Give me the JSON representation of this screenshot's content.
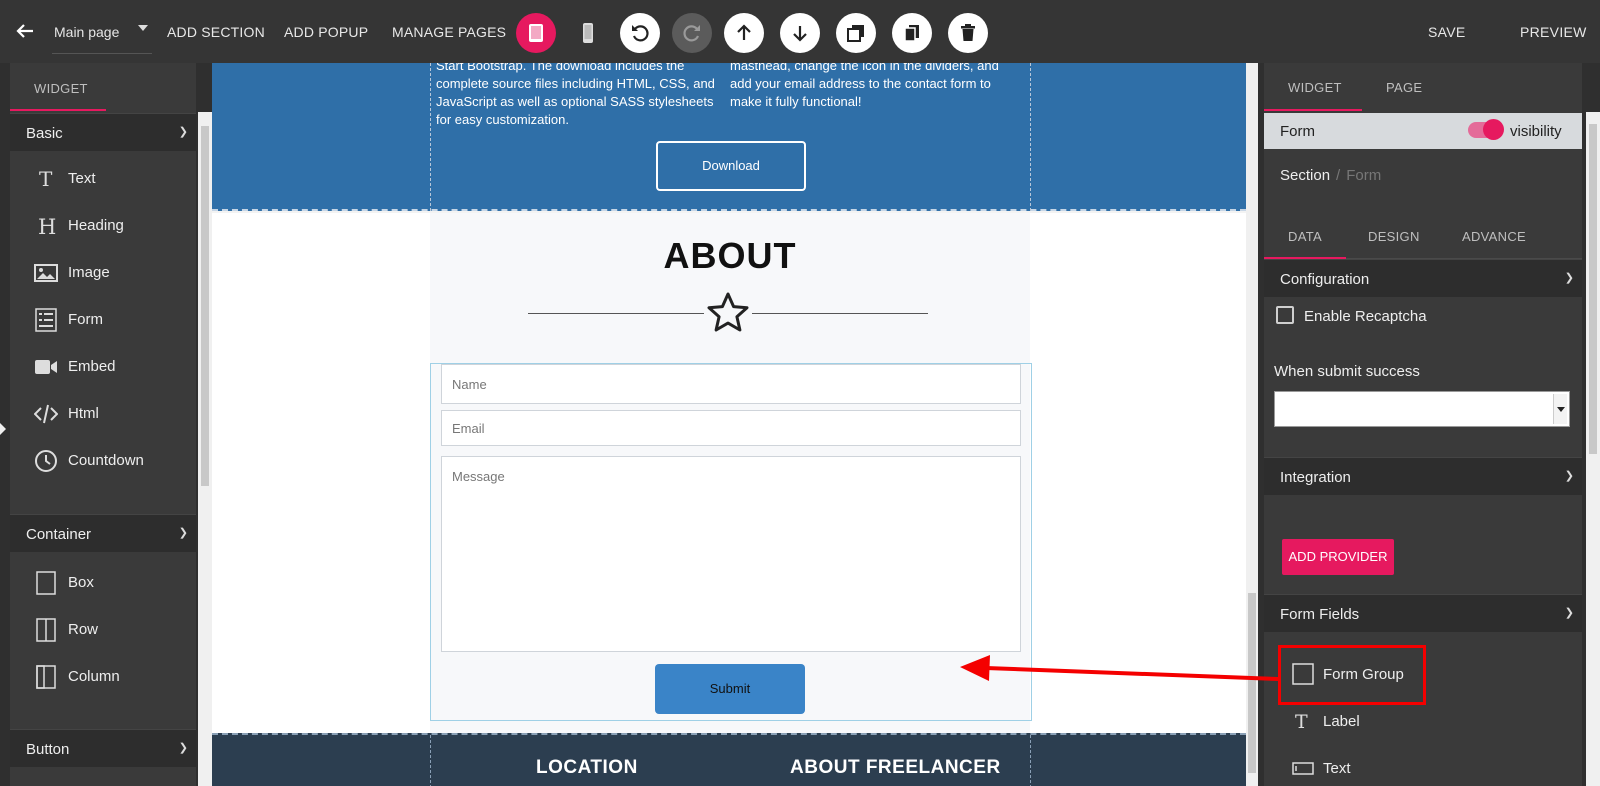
{
  "topbar": {
    "page_select": "Main page",
    "add_section": "ADD SECTION",
    "add_popup": "ADD POPUP",
    "manage_pages": "MANAGE PAGES",
    "save": "SAVE",
    "preview": "PREVIEW",
    "accent": "#e6195f"
  },
  "left": {
    "tab": "WIDGET",
    "groups": {
      "basic": "Basic",
      "container": "Container",
      "button": "Button"
    },
    "basic_items": [
      "Text",
      "Heading",
      "Image",
      "Form",
      "Embed",
      "Html",
      "Countdown"
    ],
    "container_items": [
      "Box",
      "Row",
      "Column"
    ]
  },
  "canvas": {
    "hero_col1": "Start Bootstrap. The download includes the complete source files including HTML, CSS, and JavaScript as well as optional SASS stylesheets for easy customization.",
    "hero_col2": "masthead, change the icon in the dividers, and add your email address to the contact form to make it fully functional!",
    "download": "Download",
    "about_title": "ABOUT",
    "name_placeholder": "Name",
    "email_placeholder": "Email",
    "message_placeholder": "Message",
    "submit": "Submit",
    "footer_location": "LOCATION",
    "footer_about": "ABOUT FREELANCER",
    "hero_color": "#2f6fa8"
  },
  "right": {
    "tab_widget": "WIDGET",
    "tab_page": "PAGE",
    "form_label": "Form",
    "visibility": "visibility",
    "crumb_section": "Section",
    "crumb_sep": "/",
    "crumb_form": "Form",
    "subtab_data": "DATA",
    "subtab_design": "DESIGN",
    "subtab_advance": "ADVANCE",
    "configuration": "Configuration",
    "enable_recaptcha": "Enable Recaptcha",
    "when_submit_success": "When submit success",
    "integration": "Integration",
    "add_provider": "ADD PROVIDER",
    "form_fields": "Form Fields",
    "fields": [
      "Form Group",
      "Label",
      "Text"
    ]
  }
}
